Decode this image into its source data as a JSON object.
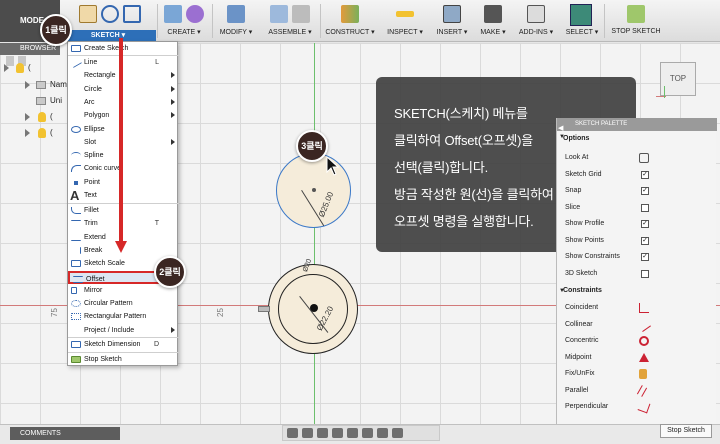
{
  "toolbar": {
    "mode_label": "MODE",
    "groups": [
      {
        "label": "SKETCH ▾"
      },
      {
        "label": "CREATE ▾"
      },
      {
        "label": "MODIFY ▾"
      },
      {
        "label": "ASSEMBLE ▾"
      },
      {
        "label": "CONSTRUCT ▾"
      },
      {
        "label": "INSPECT ▾"
      },
      {
        "label": "INSERT ▾"
      },
      {
        "label": "MAKE ▾"
      },
      {
        "label": "ADD-INS ▾"
      },
      {
        "label": "SELECT ▾"
      },
      {
        "label": "STOP SKETCH"
      }
    ]
  },
  "browser": {
    "title": "BROWSER",
    "row_labels": [
      "(",
      "Nam",
      "Uni",
      "(",
      "("
    ]
  },
  "menu": {
    "items": [
      {
        "label": "Create Sketch",
        "shortcut": ""
      },
      {
        "label": "Line",
        "shortcut": "L"
      },
      {
        "label": "Rectangle",
        "shortcut": ""
      },
      {
        "label": "Circle",
        "shortcut": ""
      },
      {
        "label": "Arc",
        "shortcut": ""
      },
      {
        "label": "Polygon",
        "shortcut": ""
      },
      {
        "label": "Ellipse",
        "shortcut": ""
      },
      {
        "label": "Slot",
        "shortcut": ""
      },
      {
        "label": "Spline",
        "shortcut": ""
      },
      {
        "label": "Conic curve",
        "shortcut": ""
      },
      {
        "label": "Point",
        "shortcut": ""
      },
      {
        "label": "Text",
        "shortcut": ""
      },
      {
        "label": "Fillet",
        "shortcut": ""
      },
      {
        "label": "Trim",
        "shortcut": "T"
      },
      {
        "label": "Extend",
        "shortcut": ""
      },
      {
        "label": "Break",
        "shortcut": ""
      },
      {
        "label": "Sketch Scale",
        "shortcut": ""
      },
      {
        "label": "Offset",
        "shortcut": ""
      },
      {
        "label": "Mirror",
        "shortcut": ""
      },
      {
        "label": "Circular Pattern",
        "shortcut": ""
      },
      {
        "label": "Rectangular Pattern",
        "shortcut": ""
      },
      {
        "label": "Project / Include",
        "shortcut": ""
      },
      {
        "label": "Sketch Dimension",
        "shortcut": "D"
      },
      {
        "label": "Stop Sketch",
        "shortcut": ""
      }
    ]
  },
  "badges": {
    "step1": "1클릭",
    "step2": "2클릭",
    "step3": "3클릭"
  },
  "tooltip": {
    "lines": [
      "SKETCH(스케치) 메뉴를",
      "클릭하여 Offset(오프셋)을",
      "선택(클릭)합니다.",
      "방금 작성한 원(선)을 클릭하여",
      "오프셋 명령을 실행합니다."
    ]
  },
  "canvas": {
    "axis_labels": [
      "75",
      "25"
    ],
    "dim_top_circle": "Ø25.00",
    "dim_bottom_outer": "Ø22.20",
    "dim_bottom_inner": "Ø20"
  },
  "viewcube": {
    "label": "TOP"
  },
  "palette": {
    "title": "SKETCH PALETTE",
    "options_title": "Options",
    "options": [
      {
        "label": "Look At",
        "checked": null
      },
      {
        "label": "Sketch Grid",
        "checked": true
      },
      {
        "label": "Snap",
        "checked": true
      },
      {
        "label": "Slice",
        "checked": false
      },
      {
        "label": "Show Profile",
        "checked": true
      },
      {
        "label": "Show Points",
        "checked": true
      },
      {
        "label": "Show Constraints",
        "checked": true
      },
      {
        "label": "3D Sketch",
        "checked": false
      }
    ],
    "constraints_title": "Constraints",
    "constraints": [
      {
        "label": "Coincident"
      },
      {
        "label": "Collinear"
      },
      {
        "label": "Concentric"
      },
      {
        "label": "Midpoint"
      },
      {
        "label": "Fix/UnFix"
      },
      {
        "label": "Parallel"
      },
      {
        "label": "Perpendicular"
      }
    ],
    "stop_button": "Stop Sketch"
  },
  "bottom": {
    "comments": "COMMENTS"
  },
  "colors": {
    "annotation_red": "#d62828",
    "menu_highlight": "#dde6f2",
    "badge_bg": "#3b2622"
  }
}
